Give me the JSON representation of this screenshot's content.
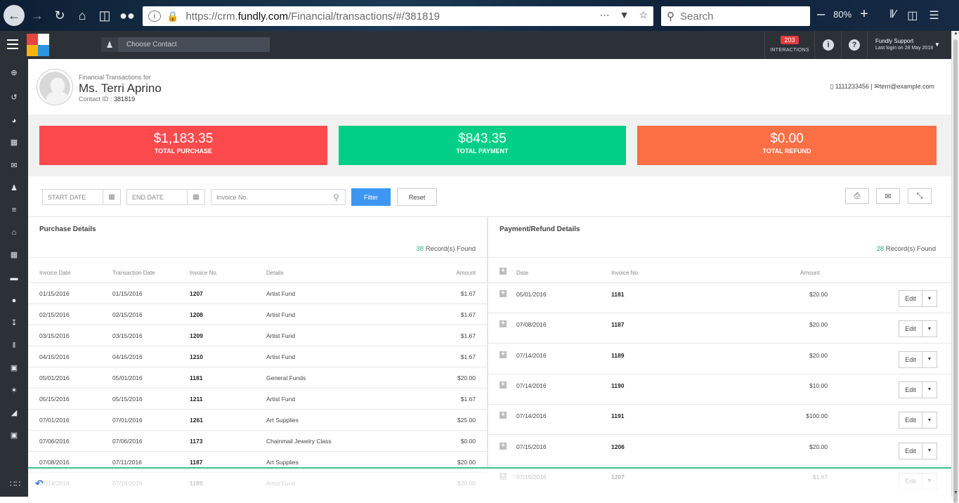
{
  "browser": {
    "url_prefix": "https://crm.",
    "url_domain": "fundly.com",
    "url_path": "/Financial/transactions/#/381819",
    "search_placeholder": "Search",
    "zoom": "80%"
  },
  "topbar": {
    "choose_contact": "Choose Contact",
    "interactions_count": "203",
    "interactions_label": "INTERACTIONS",
    "user_name": "Fundly Support",
    "last_login": "Last login on 28 May 2018"
  },
  "profile": {
    "label": "Financial Transactions for",
    "name": "Ms. Terri Aprino",
    "contact_id_label": "Contact ID :",
    "contact_id": "381819",
    "phone": "1111233456",
    "email": "terri@example.com"
  },
  "summary": [
    {
      "value": "$1,183.35",
      "label": "TOTAL PURCHASE",
      "color": "#fd4b4d"
    },
    {
      "value": "$843.35",
      "label": "TOTAL PAYMENT",
      "color": "#02cf87"
    },
    {
      "value": "$0.00",
      "label": "TOTAL REFUND",
      "color": "#fd6f45"
    }
  ],
  "filters": {
    "start_date": "START DATE",
    "end_date": "END DATE",
    "invoice_placeholder": "Invoice No.",
    "filter_label": "Filter",
    "reset_label": "Reset"
  },
  "purchase": {
    "title": "Purchase Details",
    "count": "38",
    "count_label": "Record(s) Found",
    "columns": [
      "Invoice Date",
      "Transaction Date",
      "Invoice No.",
      "Details",
      "Amount"
    ],
    "rows": [
      [
        "01/15/2016",
        "01/15/2016",
        "1207",
        "Artist Fund",
        "$1.67"
      ],
      [
        "02/15/2016",
        "02/15/2016",
        "1208",
        "Artist Fund",
        "$1.67"
      ],
      [
        "03/15/2016",
        "03/15/2016",
        "1209",
        "Artist Fund",
        "$1.67"
      ],
      [
        "04/15/2016",
        "04/15/2016",
        "1210",
        "Artist Fund",
        "$1.67"
      ],
      [
        "05/01/2016",
        "05/01/2016",
        "1181",
        "General Funds",
        "$20.00"
      ],
      [
        "05/15/2016",
        "05/15/2016",
        "1211",
        "Artist Fund",
        "$1.67"
      ],
      [
        "07/01/2016",
        "07/01/2016",
        "1261",
        "Art Supplies",
        "$25.00"
      ],
      [
        "07/06/2016",
        "07/06/2016",
        "1173",
        "Chainmail Jewelry Class",
        "$0.00"
      ],
      [
        "07/08/2016",
        "07/11/2016",
        "1187",
        "Art Supplies",
        "$20.00"
      ],
      [
        "07/14/2016",
        "07/14/2016",
        "1189",
        "Artist Fund",
        "$20.00"
      ]
    ]
  },
  "payment": {
    "title": "Payment/Refund Details",
    "count": "28",
    "count_label": "Record(s) Found",
    "columns": [
      "Date",
      "Invoice No.",
      "Amount"
    ],
    "edit_label": "Edit",
    "rows": [
      [
        "05/01/2016",
        "1181",
        "$20.00"
      ],
      [
        "07/08/2016",
        "1187",
        "$20.00"
      ],
      [
        "07/14/2016",
        "1189",
        "$20.00"
      ],
      [
        "07/14/2016",
        "1190",
        "$10.00"
      ],
      [
        "07/14/2016",
        "1191",
        "$100.00"
      ],
      [
        "07/15/2016",
        "1206",
        "$20.00"
      ],
      [
        "07/15/2016",
        "1207",
        "$1.67"
      ]
    ]
  }
}
